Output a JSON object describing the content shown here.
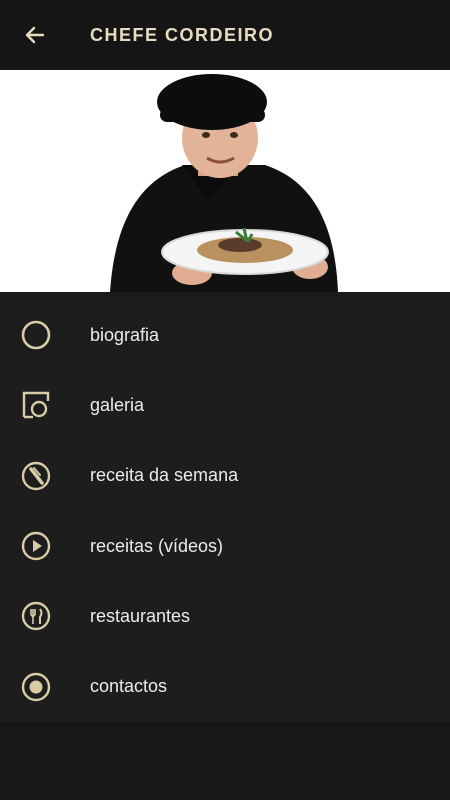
{
  "header": {
    "title": "CHEFE CORDEIRO",
    "back_icon": "arrow-left-icon"
  },
  "hero": {
    "description_icon": "chef-with-plate-illustration"
  },
  "menu": {
    "items": [
      {
        "label": "biografia",
        "icon": "circle-outline-icon"
      },
      {
        "label": "galeria",
        "icon": "gallery-icon"
      },
      {
        "label": "receita da semana",
        "icon": "knife-circle-icon"
      },
      {
        "label": "receitas (vídeos)",
        "icon": "play-circle-icon"
      },
      {
        "label": "restaurantes",
        "icon": "fork-knife-circle-icon"
      },
      {
        "label": "contactos",
        "icon": "radio-dot-icon"
      }
    ]
  },
  "colors": {
    "accent": "#d8cba6",
    "app_bar": "#151515",
    "menu_bg": "#1d1d1d",
    "text": "#ececec"
  }
}
